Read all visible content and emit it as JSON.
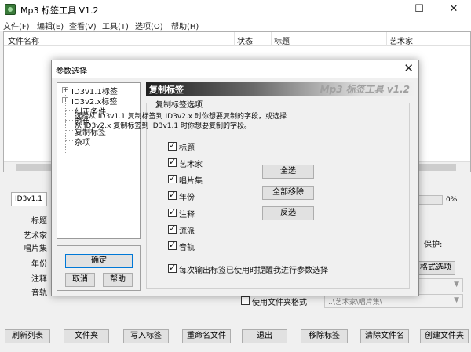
{
  "window": {
    "title": "Mp3 标签工具 V1.2",
    "minimize": "—",
    "maximize": "☐",
    "close": "✕"
  },
  "menu": [
    "文件(F)",
    "编辑(E)",
    "查看(V)",
    "工具(T)",
    "选项(O)",
    "帮助(H)"
  ],
  "file_list": {
    "columns": [
      "文件名称",
      "状态",
      "标题",
      "艺术家"
    ]
  },
  "tag_panel": {
    "tab": "ID3v1.1",
    "labels": [
      "标题",
      "艺术家",
      "唱片集",
      "年份",
      "注释",
      "音轨"
    ],
    "progress_value": 0,
    "progress_label": "0%",
    "protect_label": "保护:",
    "format_options_button": "格式选项",
    "use_folder_format_label": "使用文件夹格式",
    "folder_format_value": "..\\艺术家\\唱片集\\"
  },
  "bottom_buttons": [
    "刷新列表",
    "文件夹",
    "写入标签",
    "重命名文件",
    "退出",
    "移除标签",
    "清除文件名",
    "创建文件夹"
  ],
  "dialog": {
    "title": "参数选择",
    "close": "✕",
    "tree": [
      "ID3v1.1标签",
      "ID3v2.x标签",
      "纠正条件",
      "颜色",
      "复制标签",
      "杂项"
    ],
    "ok_button": "确定",
    "cancel_button": "取消",
    "help_button": "帮助",
    "banner_title": "复制标签",
    "banner_brand": "Mp3 标签工具 v1.2",
    "group_title": "复制标签选项",
    "description": "选择从 ID3v1.1 复制标签到 ID3v2.x 时你想要复制的字段，或选择从 ID3v2.x 复制标签到 ID3v1.1 时你想要复制的字段。",
    "fields": [
      "标题",
      "艺术家",
      "唱片集",
      "年份",
      "注释",
      "流派",
      "音轨"
    ],
    "select_all_button": "全选",
    "remove_all_button": "全部移除",
    "invert_button": "反选",
    "prompt_checkbox": "每次输出标签已使用时提醒我进行参数选择"
  }
}
